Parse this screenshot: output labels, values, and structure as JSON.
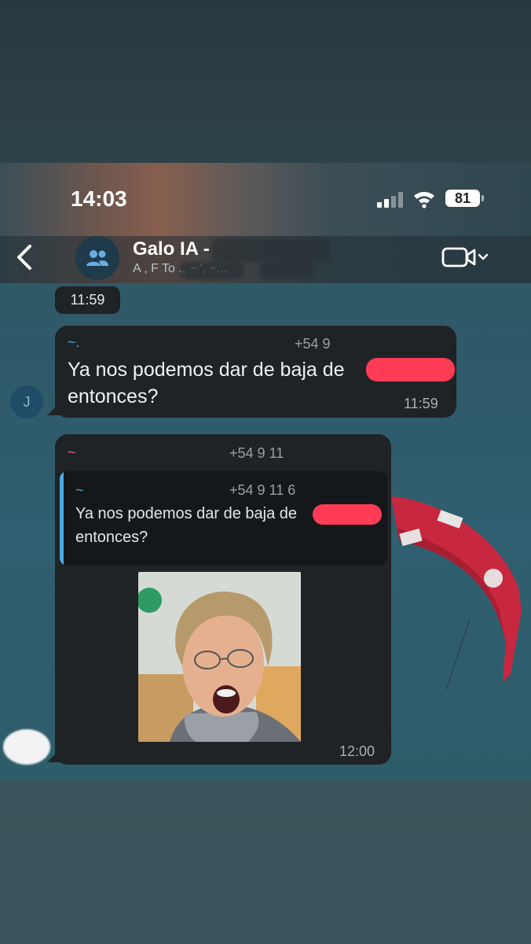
{
  "status_bar": {
    "time": "14:03",
    "battery": "81"
  },
  "header": {
    "title": "Galo IA - ",
    "subtitle": "A , F To ., ~ ', ~...",
    "icons": [
      "back-chevron-icon",
      "group-icon",
      "video-call-icon"
    ]
  },
  "date_pill": "11:59",
  "messages": [
    {
      "sender": "~.",
      "phone": "+54 9",
      "avatar_initial": "J",
      "text": "Ya nos podemos dar de baja de",
      "text_line2": "entonces?",
      "time": "11:59"
    },
    {
      "sender": "~",
      "phone": "+54 9 11",
      "reply": {
        "sender": "~",
        "phone": "+54 9 11 6",
        "text": "Ya nos podemos dar de baja de",
        "text_line2": "entonces?"
      },
      "media": "photo",
      "time": "12:00"
    }
  ],
  "colors": {
    "bubble": "#1f2325",
    "sender": "#4ba9e4",
    "reply_accent": "#4ba9e4",
    "redaction": "#ff3b55"
  }
}
